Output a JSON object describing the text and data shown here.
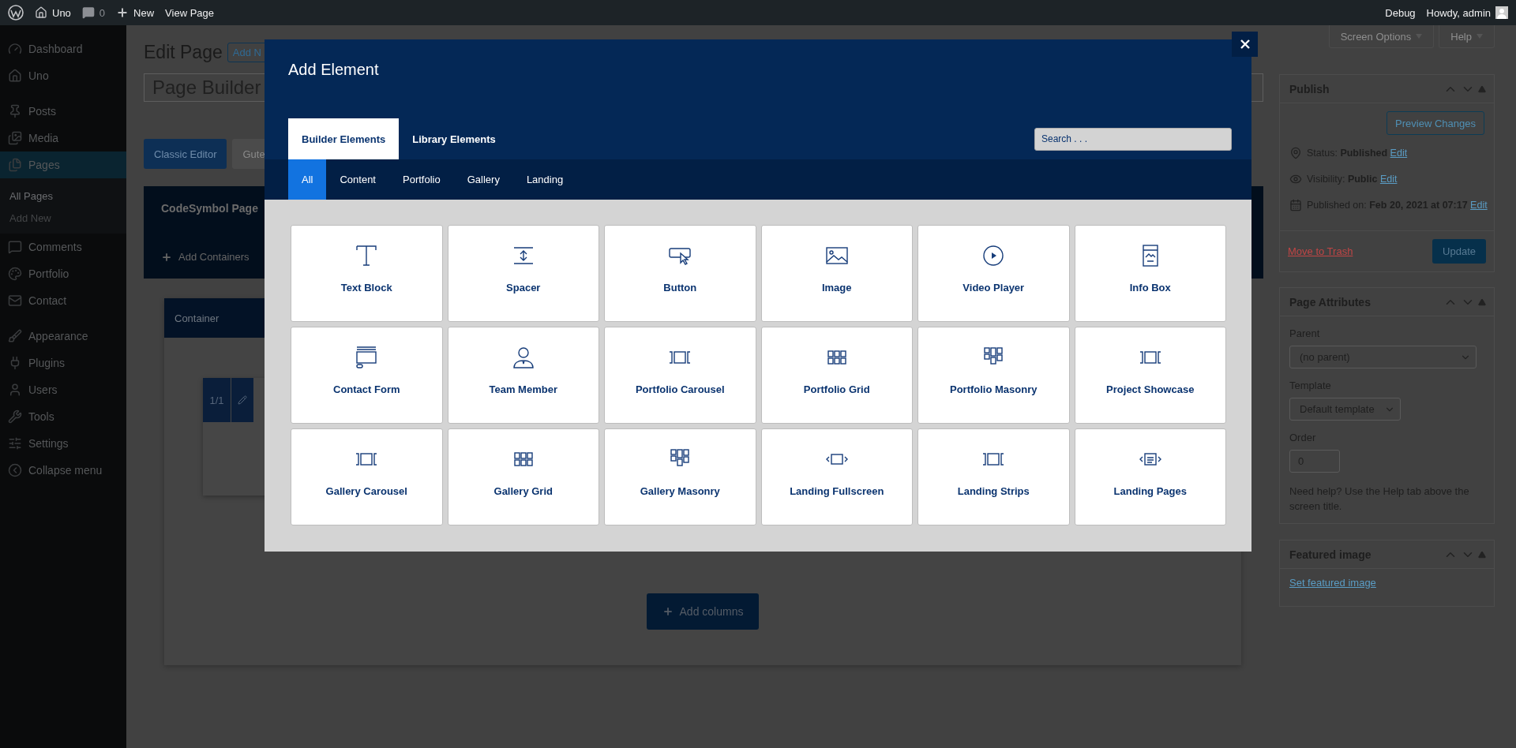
{
  "admin_bar": {
    "site": "Uno",
    "comments": "0",
    "new": "New",
    "view": "View Page",
    "debug": "Debug",
    "greeting": "Howdy, admin"
  },
  "sidebar": {
    "groups": [
      {
        "items": [
          {
            "label": "Dashboard",
            "selected": false
          },
          {
            "label": "Uno",
            "selected": false
          }
        ]
      },
      {
        "items": [
          {
            "label": "Posts",
            "selected": false
          },
          {
            "label": "Media",
            "selected": false
          },
          {
            "label": "Pages",
            "selected": true,
            "children": [
              {
                "label": "All Pages",
                "selected": true
              },
              {
                "label": "Add New",
                "selected": false
              }
            ]
          },
          {
            "label": "Comments",
            "selected": false
          },
          {
            "label": "Portfolio",
            "selected": false
          },
          {
            "label": "Contact",
            "selected": false
          }
        ]
      },
      {
        "items": [
          {
            "label": "Appearance",
            "selected": false
          },
          {
            "label": "Plugins",
            "selected": false
          },
          {
            "label": "Users",
            "selected": false
          },
          {
            "label": "Tools",
            "selected": false
          },
          {
            "label": "Settings",
            "selected": false
          },
          {
            "label": "Collapse menu",
            "selected": false
          }
        ]
      }
    ]
  },
  "editor": {
    "heading": "Edit Page",
    "add_new": "Add N",
    "title_value": "Page Builder",
    "mode_buttons": [
      {
        "label": "Classic Editor",
        "kind": "primary"
      },
      {
        "label": "Gute",
        "kind": "secondary"
      }
    ],
    "builder": {
      "title": "CodeSymbol Page",
      "add_containers": "Add Containers",
      "container": {
        "title": "Container",
        "column_size": "1/1"
      },
      "add_columns": "Add columns"
    }
  },
  "screen_buttons": [
    "Screen Options",
    "Help"
  ],
  "publish": {
    "title": "Publish",
    "preview": "Preview Changes",
    "lines": [
      {
        "kind": "pin",
        "text": "Status: **Published**",
        "link": "Edit"
      },
      {
        "kind": "eye",
        "text": "Visibility: **Public**",
        "link": "Edit"
      },
      {
        "kind": "calendar",
        "text": "Published on: **Feb 20, 2021 at 07:17**",
        "link": "Edit"
      }
    ],
    "trash": "Move to Trash",
    "update": "Update"
  },
  "page_attributes": {
    "title": "Page Attributes",
    "parent_label": "Parent",
    "parent_value": "(no parent)",
    "template_label": "Template",
    "template_value": "Default template",
    "order_label": "Order",
    "order_value": "0",
    "help": "Need help? Use the Help tab above the screen title."
  },
  "featured_image": {
    "title": "Featured image",
    "link": "Set featured image"
  },
  "modal": {
    "title": "Add Element",
    "tabs": [
      {
        "label": "Builder Elements",
        "selected": true
      },
      {
        "label": "Library Elements",
        "selected": false
      }
    ],
    "search": {
      "placeholder": "Search . . ."
    },
    "filters": [
      {
        "label": "All",
        "selected": true
      },
      {
        "label": "Content",
        "selected": false
      },
      {
        "label": "Portfolio",
        "selected": false
      },
      {
        "label": "Gallery",
        "selected": false
      },
      {
        "label": "Landing",
        "selected": false
      }
    ],
    "elements": [
      {
        "label": "Text Block",
        "kind": "text"
      },
      {
        "label": "Spacer",
        "kind": "spacer"
      },
      {
        "label": "Button",
        "kind": "button"
      },
      {
        "label": "Image",
        "kind": "image"
      },
      {
        "label": "Video Player",
        "kind": "video"
      },
      {
        "label": "Info Box",
        "kind": "info"
      },
      {
        "label": "Contact Form",
        "kind": "form"
      },
      {
        "label": "Team Member",
        "kind": "person"
      },
      {
        "label": "Portfolio Carousel",
        "kind": "carousel"
      },
      {
        "label": "Portfolio Grid",
        "kind": "grid"
      },
      {
        "label": "Portfolio Masonry",
        "kind": "masonry"
      },
      {
        "label": "Project Showcase",
        "kind": "carousel"
      },
      {
        "label": "Gallery Carousel",
        "kind": "carousel"
      },
      {
        "label": "Gallery Grid",
        "kind": "grid"
      },
      {
        "label": "Gallery Masonry",
        "kind": "masonry"
      },
      {
        "label": "Landing Fullscreen",
        "kind": "fullscreen"
      },
      {
        "label": "Landing Strips",
        "kind": "carousel"
      },
      {
        "label": "Landing Pages",
        "kind": "pages"
      }
    ]
  }
}
